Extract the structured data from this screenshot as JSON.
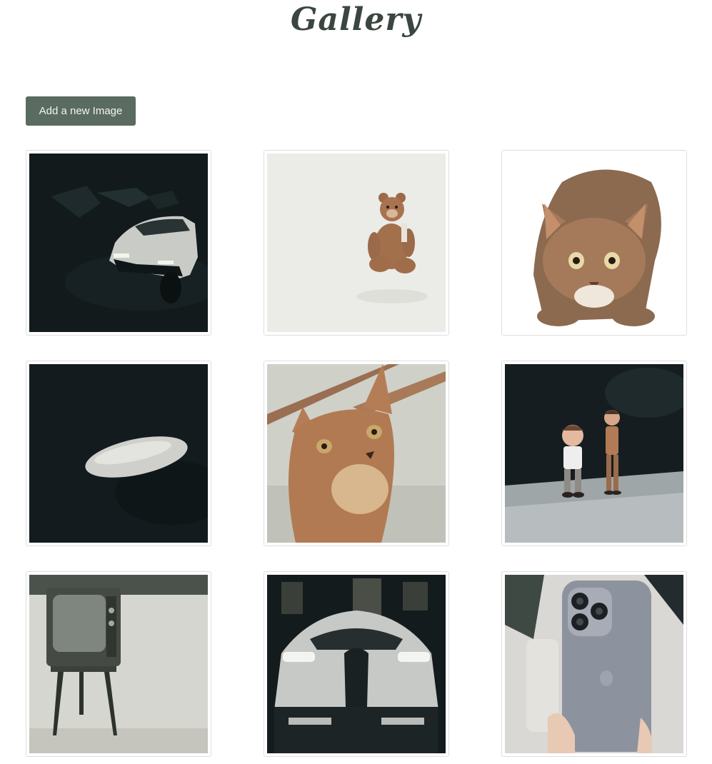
{
  "header": {
    "title": "Gallery"
  },
  "toolbar": {
    "add_label": "Add a new Image"
  },
  "colors": {
    "title": "#3a463f",
    "button_bg": "#5a6b61",
    "button_text": "#f3f5f3",
    "card_border": "#dedede"
  },
  "gallery": {
    "images": [
      {
        "subject": "car-dark-garage"
      },
      {
        "subject": "teddy-bear"
      },
      {
        "subject": "cat-crouching"
      },
      {
        "subject": "computer-mouse"
      },
      {
        "subject": "cat-portrait"
      },
      {
        "subject": "toy-figurines"
      },
      {
        "subject": "retro-tv"
      },
      {
        "subject": "sports-car"
      },
      {
        "subject": "smartphone"
      }
    ]
  }
}
